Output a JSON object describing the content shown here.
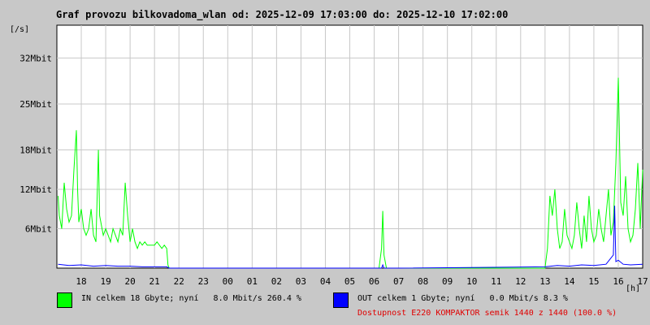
{
  "title": "Graf provozu bilkovadoma_wlan od: 2025-12-09 17:03:00 do: 2025-12-10 17:02:00",
  "legend": {
    "in": {
      "text": "IN celkem 18 Gbyte; nyní   8.0 Mbit/s 260.4 %",
      "color": "#00ff00"
    },
    "out": {
      "text": "OUT celkem 1 Gbyte; nyní   0.0 Mbit/s 8.3 %",
      "color": "#0000ff"
    }
  },
  "availability": "Dostupnost E220 KOMPAKTOR semik 1440 z 1440 (100.0 %)",
  "chart_data": {
    "type": "line",
    "ylabel": "[/s]",
    "xlabel": "[h]",
    "ylim": [
      0,
      37
    ],
    "y_ticks": [
      {
        "value": 6,
        "label": "6Mbit"
      },
      {
        "value": 12,
        "label": "12Mbit"
      },
      {
        "value": 18,
        "label": "18Mbit"
      },
      {
        "value": 25,
        "label": "25Mbit"
      },
      {
        "value": 32,
        "label": "32Mbit"
      }
    ],
    "x_ticks": [
      "18",
      "19",
      "20",
      "21",
      "22",
      "23",
      "00",
      "01",
      "02",
      "03",
      "04",
      "05",
      "06",
      "07",
      "08",
      "09",
      "10",
      "11",
      "12",
      "13",
      "14",
      "15",
      "16",
      "17"
    ],
    "grid": true,
    "series": [
      {
        "name": "IN",
        "color": "#00ff00",
        "x": [
          17.05,
          17.1,
          17.2,
          17.3,
          17.4,
          17.5,
          17.6,
          17.7,
          17.8,
          17.85,
          17.9,
          18.0,
          18.1,
          18.2,
          18.3,
          18.4,
          18.5,
          18.6,
          18.7,
          18.75,
          18.8,
          18.9,
          19.0,
          19.1,
          19.2,
          19.3,
          19.4,
          19.5,
          19.6,
          19.7,
          19.8,
          19.9,
          20.0,
          20.1,
          20.2,
          20.3,
          20.4,
          20.5,
          20.6,
          20.7,
          20.8,
          20.9,
          21.0,
          21.1,
          21.2,
          21.3,
          21.4,
          21.5,
          21.55,
          21.6,
          22.0,
          23.0,
          24.0,
          25.0,
          26.0,
          27.0,
          28.0,
          29.0,
          30.0,
          30.2,
          30.3,
          30.35,
          30.4,
          30.5,
          31.0,
          32.0,
          33.0,
          34.0,
          35.0,
          36.0,
          37.0,
          37.1,
          37.2,
          37.3,
          37.4,
          37.5,
          37.6,
          37.7,
          37.8,
          37.9,
          38.0,
          38.1,
          38.2,
          38.3,
          38.4,
          38.5,
          38.6,
          38.7,
          38.8,
          38.9,
          39.0,
          39.1,
          39.2,
          39.3,
          39.4,
          39.5,
          39.6,
          39.7,
          39.8,
          39.9,
          40.0,
          40.1,
          40.2,
          40.3,
          40.4,
          40.5,
          40.6,
          40.7,
          40.8,
          40.9,
          41.0
        ],
        "values": [
          11,
          8,
          6,
          13,
          9,
          7,
          8,
          15,
          21,
          12,
          7,
          9,
          6,
          5,
          6,
          9,
          5,
          4,
          18,
          8,
          7,
          5,
          6,
          5,
          4,
          6,
          5,
          4,
          6,
          5,
          13,
          8,
          4,
          6,
          4,
          3,
          4,
          3.5,
          4,
          3.5,
          3.5,
          3.5,
          3.5,
          4,
          3.5,
          3,
          3.5,
          3,
          0.5,
          0,
          0,
          0,
          0,
          0,
          0,
          0,
          0,
          0,
          0,
          0,
          3,
          8.7,
          2,
          0,
          0,
          0,
          0,
          0,
          0,
          0,
          0,
          3,
          11,
          8,
          12,
          6,
          3,
          4,
          9,
          5,
          4,
          3,
          5,
          10,
          6,
          3,
          8,
          4,
          11,
          6,
          4,
          5,
          9,
          6,
          4,
          8,
          12,
          5,
          7,
          16,
          29,
          10,
          8,
          14,
          6,
          4,
          5,
          9,
          16,
          6,
          15
        ]
      },
      {
        "name": "OUT",
        "color": "#0000ff",
        "x": [
          17.05,
          17.5,
          18.0,
          18.5,
          19.0,
          19.5,
          20.0,
          20.5,
          21.0,
          21.5,
          21.6,
          22.0,
          30.0,
          30.3,
          30.35,
          30.4,
          31.0,
          37.0,
          37.5,
          38.0,
          38.5,
          39.0,
          39.5,
          39.8,
          39.85,
          39.9,
          40.0,
          40.2,
          40.5,
          41.0
        ],
        "values": [
          0.6,
          0.4,
          0.5,
          0.3,
          0.4,
          0.3,
          0.3,
          0.2,
          0.2,
          0.2,
          0,
          0,
          0,
          0,
          0.5,
          0,
          0,
          0.2,
          0.4,
          0.3,
          0.5,
          0.4,
          0.6,
          2,
          9.5,
          1,
          1.2,
          0.6,
          0.5,
          0.6
        ]
      }
    ]
  }
}
